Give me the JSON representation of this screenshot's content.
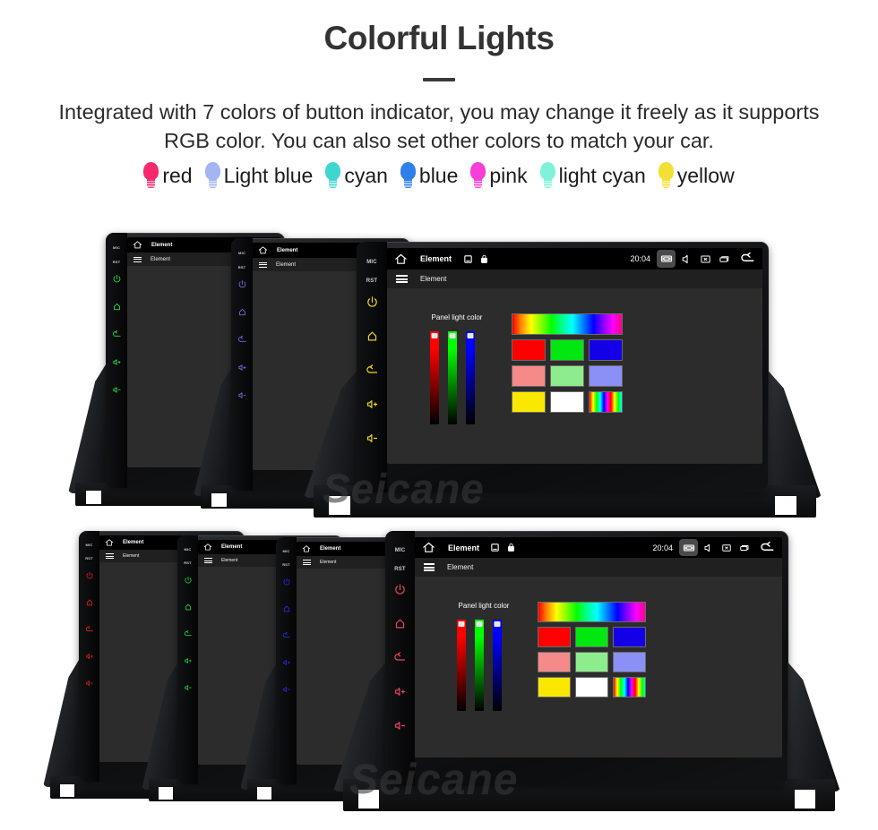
{
  "header": {
    "title": "Colorful Lights",
    "subtitle": "Integrated with 7 colors of button indicator, you may change it freely as it supports RGB color. You can also set other colors to match your car."
  },
  "legend": {
    "items": [
      {
        "label": "red",
        "color": "#F6296A"
      },
      {
        "label": "Light blue",
        "color": "#A3B6F2"
      },
      {
        "label": "cyan",
        "color": "#3FD6D2"
      },
      {
        "label": "blue",
        "color": "#2E7FE8"
      },
      {
        "label": "pink",
        "color": "#F53FD6"
      },
      {
        "label": "light cyan",
        "color": "#7FF2D9"
      },
      {
        "label": "yellow",
        "color": "#F2E135"
      }
    ]
  },
  "screen": {
    "status_bar": {
      "home_icon": "home-icon",
      "title": "Element",
      "sd_icon": "sd-card-icon",
      "lock_icon": "lock-icon",
      "time": "20:04",
      "screenshot_icon": "screenshot-icon",
      "volume_icon": "volume-icon",
      "close_box_icon": "close-box-icon",
      "recent_apps_icon": "recent-apps-icon",
      "back_icon": "back-icon"
    },
    "app_bar": {
      "menu_icon": "hamburger-menu-icon",
      "title": "Element"
    },
    "panel": {
      "label": "Panel light color",
      "sliders": [
        {
          "name": "red-slider",
          "color": "#ff0000",
          "value": 100
        },
        {
          "name": "green-slider",
          "color": "#00ff00",
          "value": 100
        },
        {
          "name": "blue-slider",
          "color": "#0000ff",
          "value": 100
        }
      ],
      "hue_bar": "hue-gradient-bar",
      "swatch_rows": [
        [
          {
            "name": "swatch-red",
            "color": "#ff0000"
          },
          {
            "name": "swatch-green",
            "color": "#00e810"
          },
          {
            "name": "swatch-blue",
            "color": "#1400e6"
          }
        ],
        [
          {
            "name": "swatch-light-red",
            "color": "#f58b89"
          },
          {
            "name": "swatch-light-green",
            "color": "#8ded8c"
          },
          {
            "name": "swatch-light-blue",
            "color": "#8a90f5"
          }
        ],
        [
          {
            "name": "swatch-yellow",
            "color": "#fbe800"
          },
          {
            "name": "swatch-white",
            "color": "#ffffff"
          },
          {
            "name": "swatch-rainbow",
            "color": "rainbow"
          }
        ]
      ]
    }
  },
  "units": {
    "top_row": [
      {
        "name": "unit-green",
        "button_color": "#2BE04A"
      },
      {
        "name": "unit-purple",
        "button_color": "#7B6BE8"
      },
      {
        "name": "unit-yellow",
        "button_color": "#EEDB1E"
      }
    ],
    "bottom_row": [
      {
        "name": "unit-red",
        "button_color": "#E81E1E"
      },
      {
        "name": "unit-green",
        "button_color": "#21D63C"
      },
      {
        "name": "unit-blue",
        "button_color": "#2B2BF0"
      },
      {
        "name": "unit-pink",
        "button_color": "#E8455C"
      }
    ],
    "key_labels": {
      "mic": "MIC",
      "rst": "RST"
    }
  },
  "watermark": {
    "text": "Seicane"
  }
}
